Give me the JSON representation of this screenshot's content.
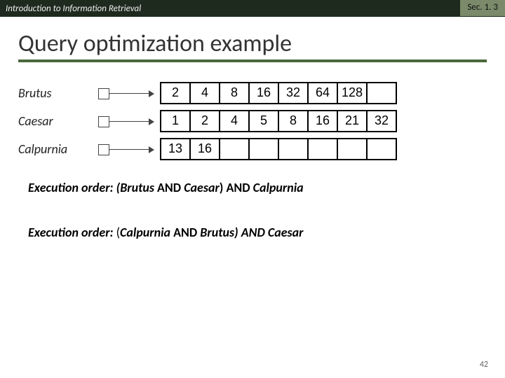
{
  "header": {
    "left": "Introduction to Information Retrieval",
    "right": "Sec. 1. 3"
  },
  "title": "Query optimization example",
  "terms": [
    {
      "name": "Brutus",
      "postings": [
        "2",
        "4",
        "8",
        "16",
        "32",
        "64",
        "128",
        ""
      ]
    },
    {
      "name": "Caesar",
      "postings": [
        "1",
        "2",
        "4",
        "5",
        "8",
        "16",
        "21",
        "32"
      ]
    },
    {
      "name": "Calpurnia",
      "postings": [
        "13",
        "16",
        "",
        "",
        "",
        "",
        "",
        ""
      ]
    }
  ],
  "orders": {
    "label": "Execution order:",
    "first_prefix": "(",
    "first_a": "Brutus",
    "first_and1": " AND ",
    "first_b": "Caesar",
    "first_mid": ") AND ",
    "first_c": "Calpurnia",
    "second_prefix": "(",
    "second_a": "Calpurnia",
    "second_and1": " AND ",
    "second_b": "Brutus",
    "second_mid": ") AND ",
    "second_c": "Caesar"
  },
  "page_number": "42"
}
